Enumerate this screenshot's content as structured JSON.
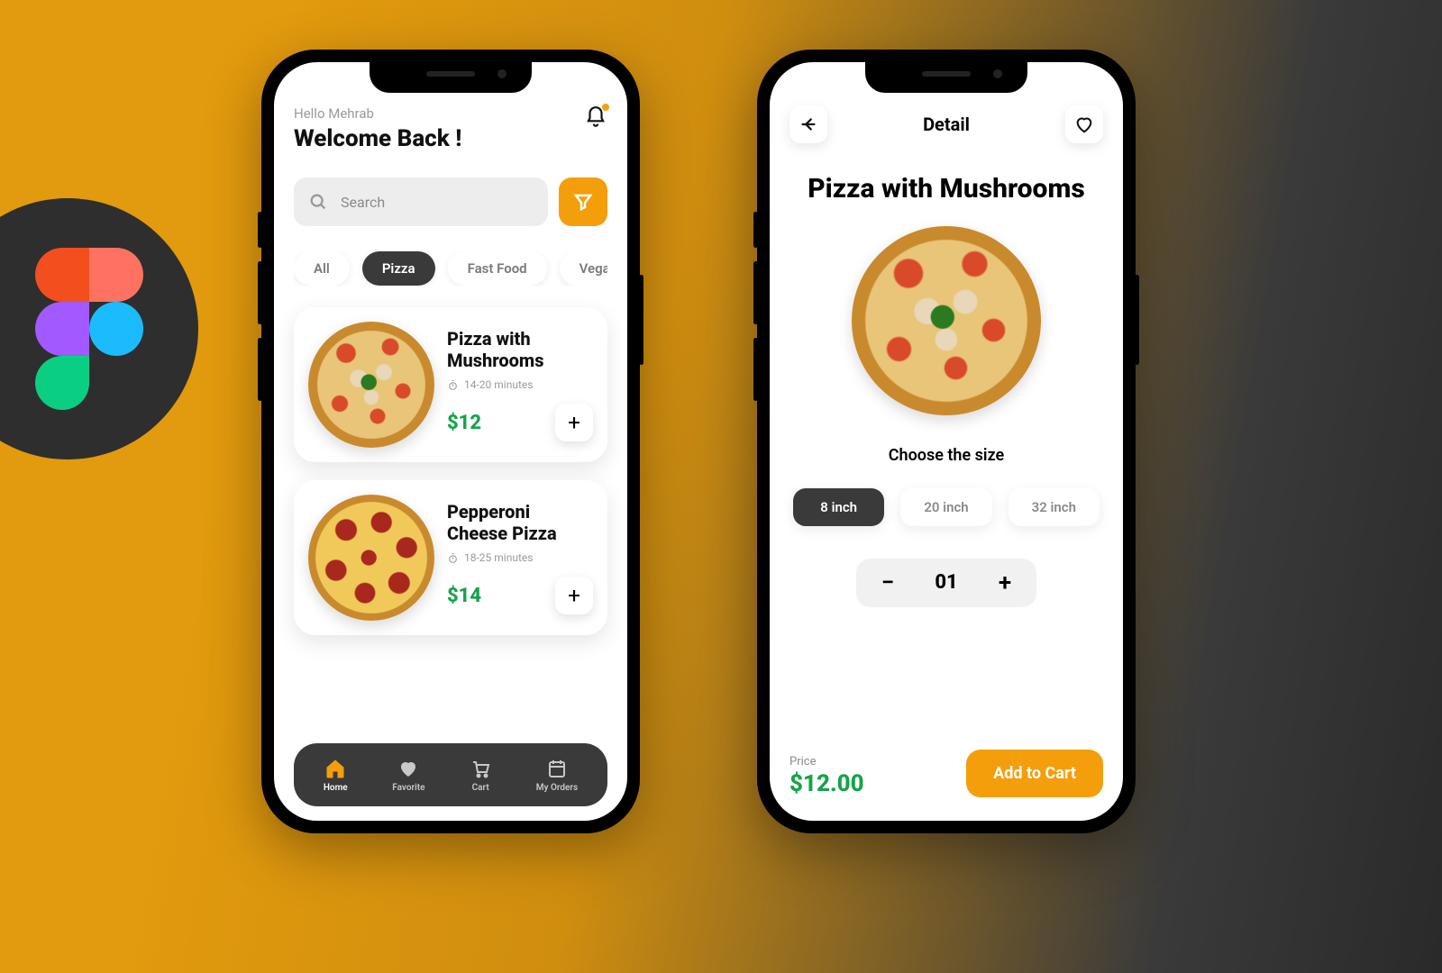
{
  "home": {
    "greeting": "Hello Mehrab",
    "welcome": "Welcome Back !",
    "search_placeholder": "Search",
    "categories": [
      {
        "label": "All",
        "active": false
      },
      {
        "label": "Pizza",
        "active": true
      },
      {
        "label": "Fast Food",
        "active": false
      },
      {
        "label": "Vegan",
        "active": false
      }
    ],
    "items": [
      {
        "name": "Pizza with Mushrooms",
        "time": "14-20 minutes",
        "price": "$12"
      },
      {
        "name": "Pepperoni Cheese Pizza",
        "time": "18-25 minutes",
        "price": "$14"
      }
    ],
    "tabs": [
      {
        "label": "Home",
        "active": true
      },
      {
        "label": "Favorite",
        "active": false
      },
      {
        "label": "Cart",
        "active": false
      },
      {
        "label": "My Orders",
        "active": false
      }
    ]
  },
  "detail": {
    "header_title": "Detail",
    "title": "Pizza with Mushrooms",
    "choose_label": "Choose the size",
    "sizes": [
      {
        "label": "8 inch",
        "active": true
      },
      {
        "label": "20 inch",
        "active": false
      },
      {
        "label": "32 inch",
        "active": false
      }
    ],
    "quantity": "01",
    "price_label": "Price",
    "price": "$12.00",
    "cta": "Add to Cart"
  },
  "colors": {
    "accent": "#F59E0B",
    "success": "#16A34A",
    "dark": "#3A3A3A"
  }
}
